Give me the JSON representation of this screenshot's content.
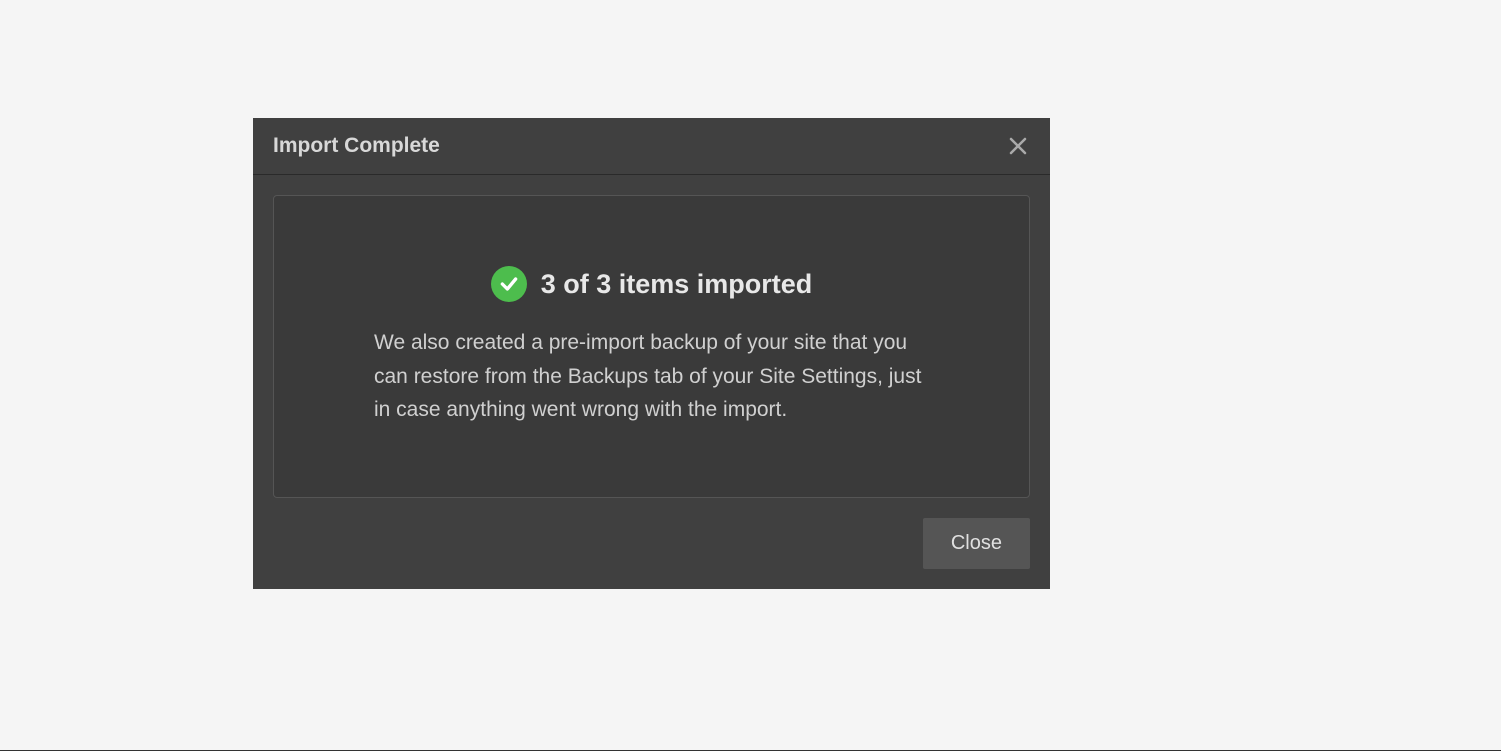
{
  "dialog": {
    "title": "Import Complete",
    "result_summary": "3 of 3 items imported",
    "description": "We also created a pre-import backup of your site that you can restore from the Backups tab of your Site Settings, just in case anything went wrong with the import.",
    "close_button_label": "Close",
    "success_icon": "check-circle",
    "success_color": "#4dbd4d"
  }
}
